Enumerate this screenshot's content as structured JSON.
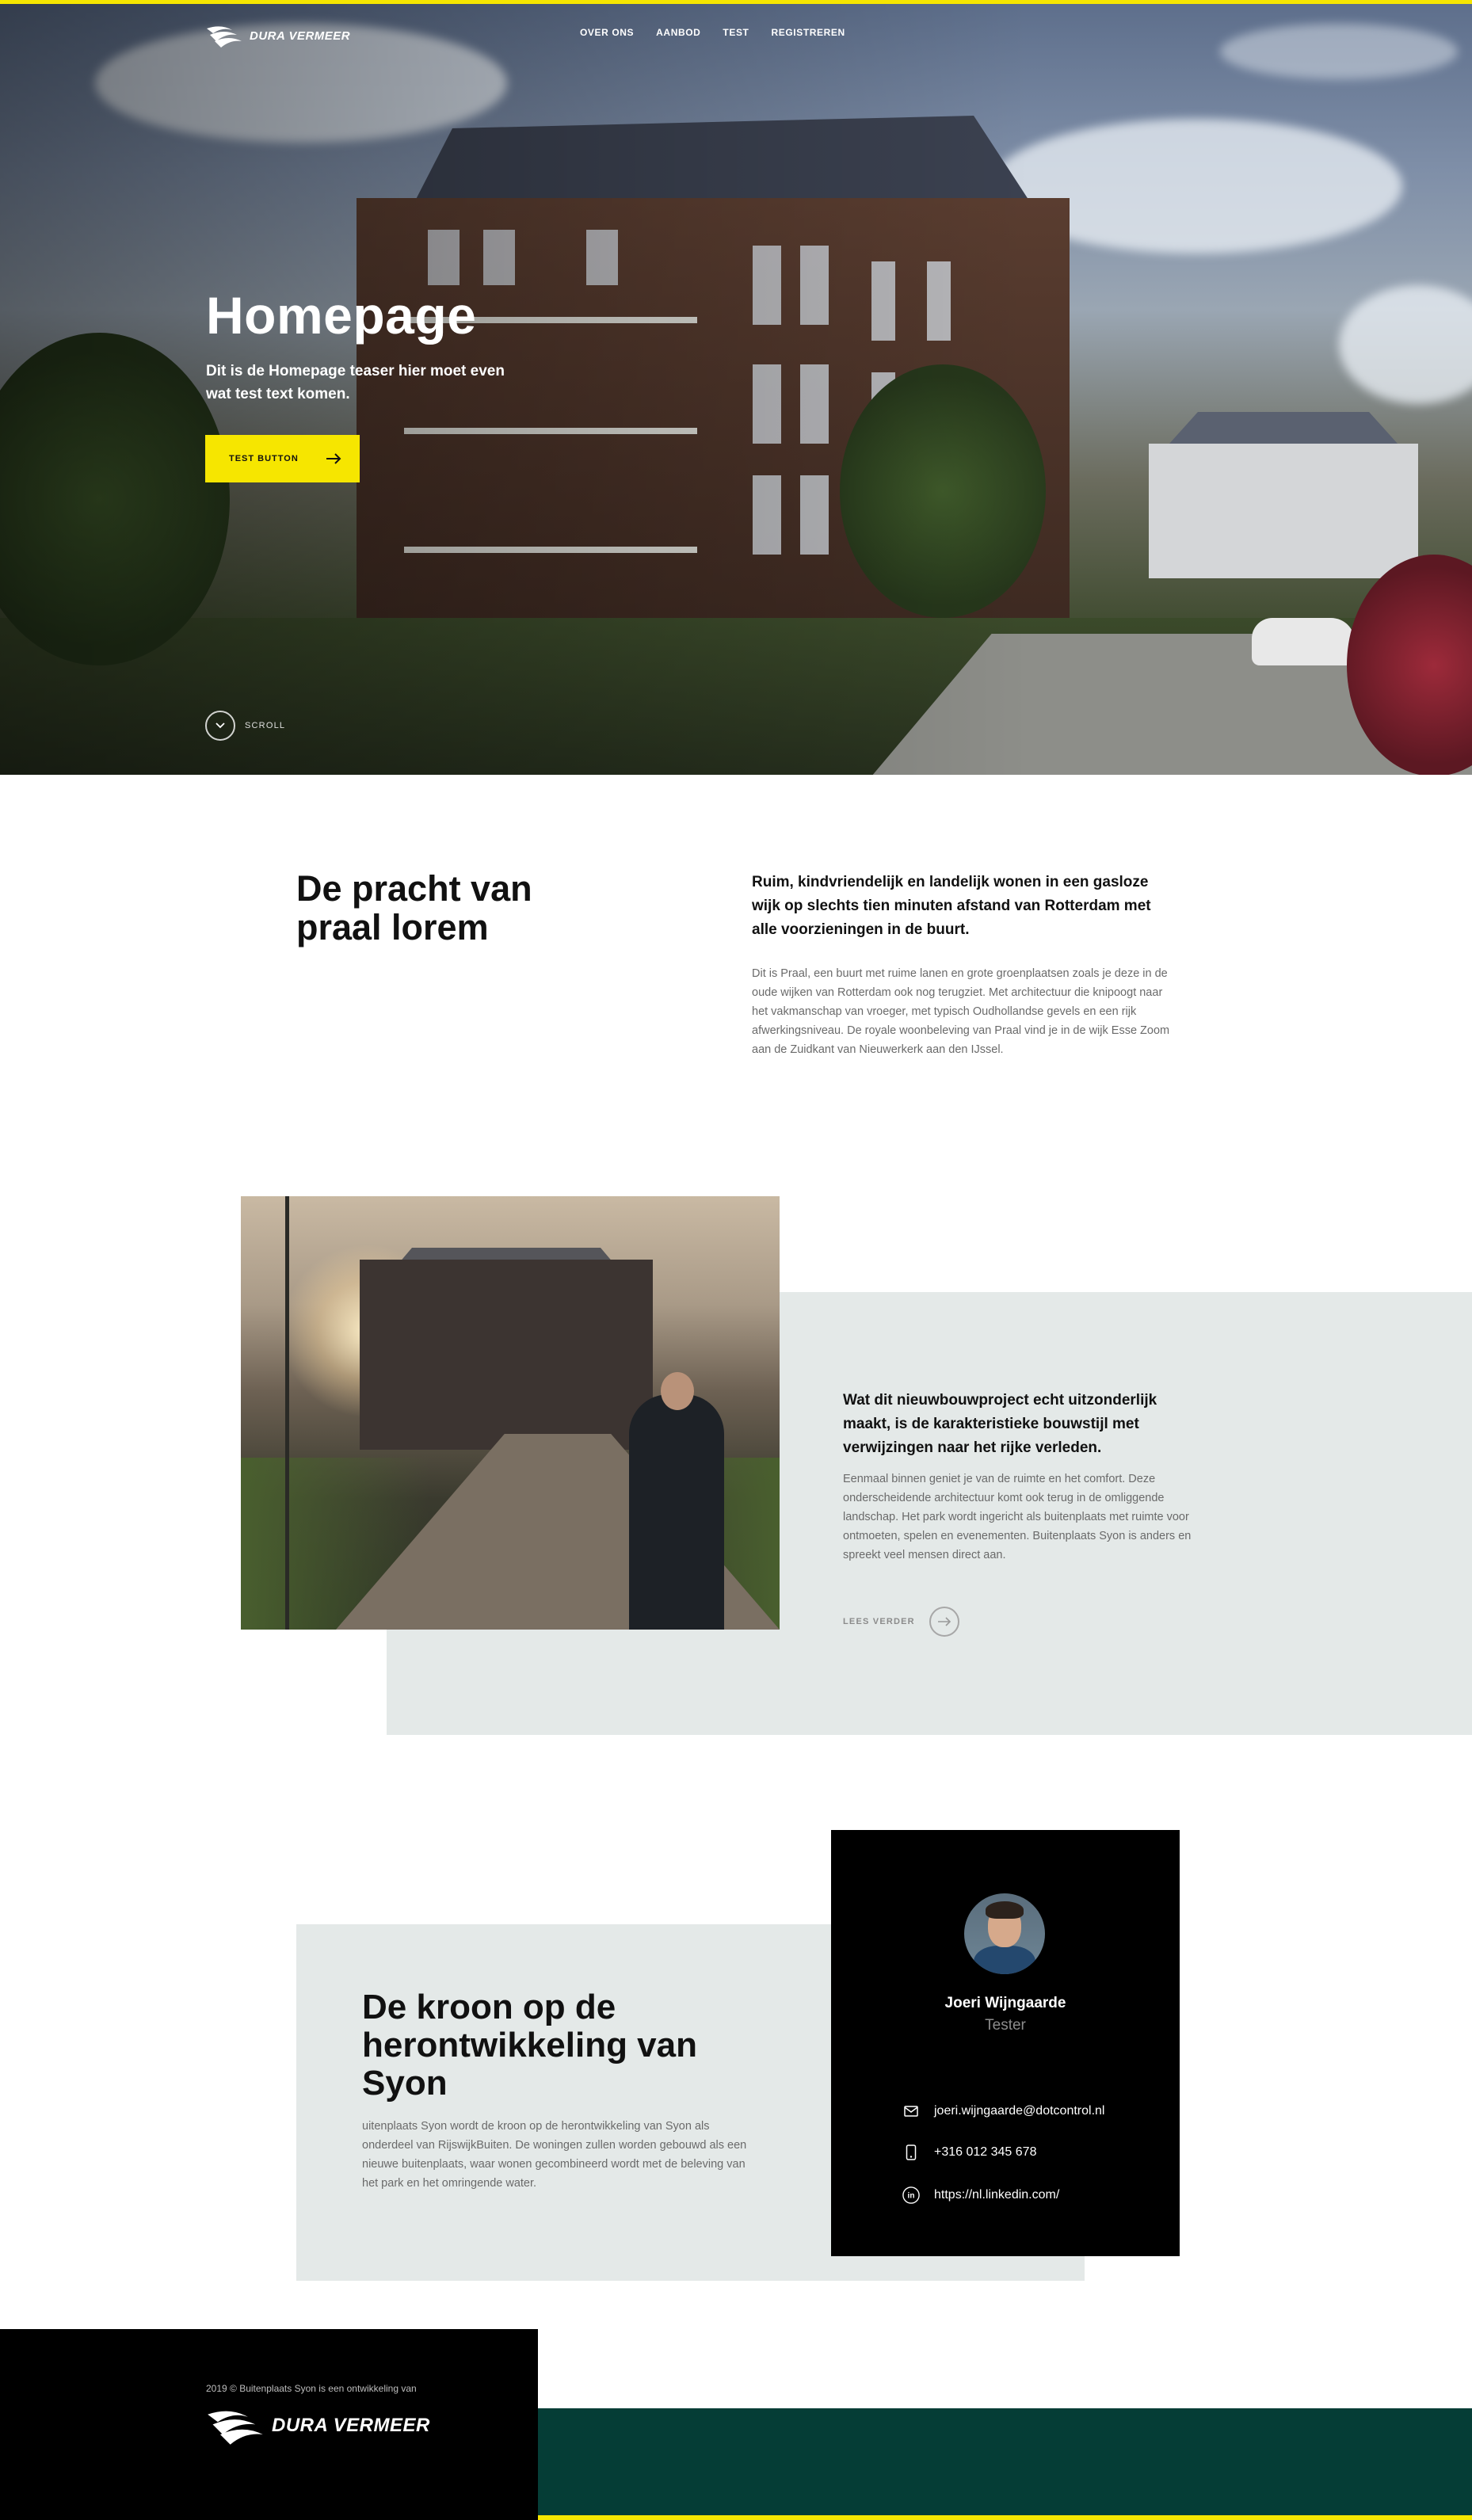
{
  "brand": {
    "logo_text": "DURA VERMEER",
    "accent_color": "#f6e600",
    "dark_green": "#053d36",
    "panel_gray": "#e4e9e8"
  },
  "nav": {
    "items": [
      {
        "label": "OVER ONS"
      },
      {
        "label": "AANBOD"
      },
      {
        "label": "TEST"
      },
      {
        "label": "REGISTREREN"
      }
    ]
  },
  "hero": {
    "title": "Homepage",
    "teaser": "Dit is de Homepage teaser hier moet even wat test text komen.",
    "button_label": "TEST BUTTON",
    "button_icon": "arrow-right-icon",
    "scroll_label": "SCROLL",
    "scroll_icon": "chevron-down-icon"
  },
  "intro": {
    "title": "De pracht van praal lorem",
    "lead": "Ruim, kindvriendelijk en landelijk wonen in een gasloze wijk op slechts tien minuten afstand van Rotterdam met alle voorzieningen in de buurt.",
    "body": "Dit is Praal, een buurt met ruime lanen en grote groenplaatsen zoals je deze in de oude wijken van Rotterdam ook nog terugziet. Met architectuur die knipoogt naar het vakmanschap van vroeger, met typisch Oudhollandse gevels en een rijk afwerkingsniveau. De royale woonbeleving van Praal vind je in de wijk Esse Zoom aan de Zuidkant van Nieuwerkerk aan den IJssel."
  },
  "feature": {
    "lead": "Wat dit nieuwbouwproject echt uitzonderlijk maakt, is de karakteristieke bouwstijl met verwijzingen naar het rijke verleden.",
    "body": "Eenmaal binnen geniet je van de ruimte en het comfort. Deze onderscheidende architectuur komt ook terug in de omliggende landschap. Het park wordt ingericht als buitenplaats met ruimte voor ontmoeten, spelen en evenementen. Buitenplaats Syon is anders en spreekt veel mensen direct aan.",
    "read_more_label": "LEES VERDER",
    "read_more_icon": "arrow-right-icon"
  },
  "contact_section": {
    "title": "De kroon op de herontwikkeling van Syon",
    "body": "uitenplaats Syon wordt de kroon op de herontwikkeling van Syon als onderdeel van RijswijkBuiten. De woningen zullen worden gebouwd als een nieuwe buitenplaats, waar wonen gecombineerd wordt met de beleving van het park en het omringende water."
  },
  "contact_card": {
    "name": "Joeri Wijngaarde",
    "role": "Tester",
    "email": "joeri.wijngaarde@dotcontrol.nl",
    "phone": "+316 012 345 678",
    "linkedin": "https://nl.linkedin.com/"
  },
  "footer": {
    "copyright": "2019 © Buitenplaats Syon is een ontwikkeling van",
    "logo_text": "DURA VERMEER"
  }
}
